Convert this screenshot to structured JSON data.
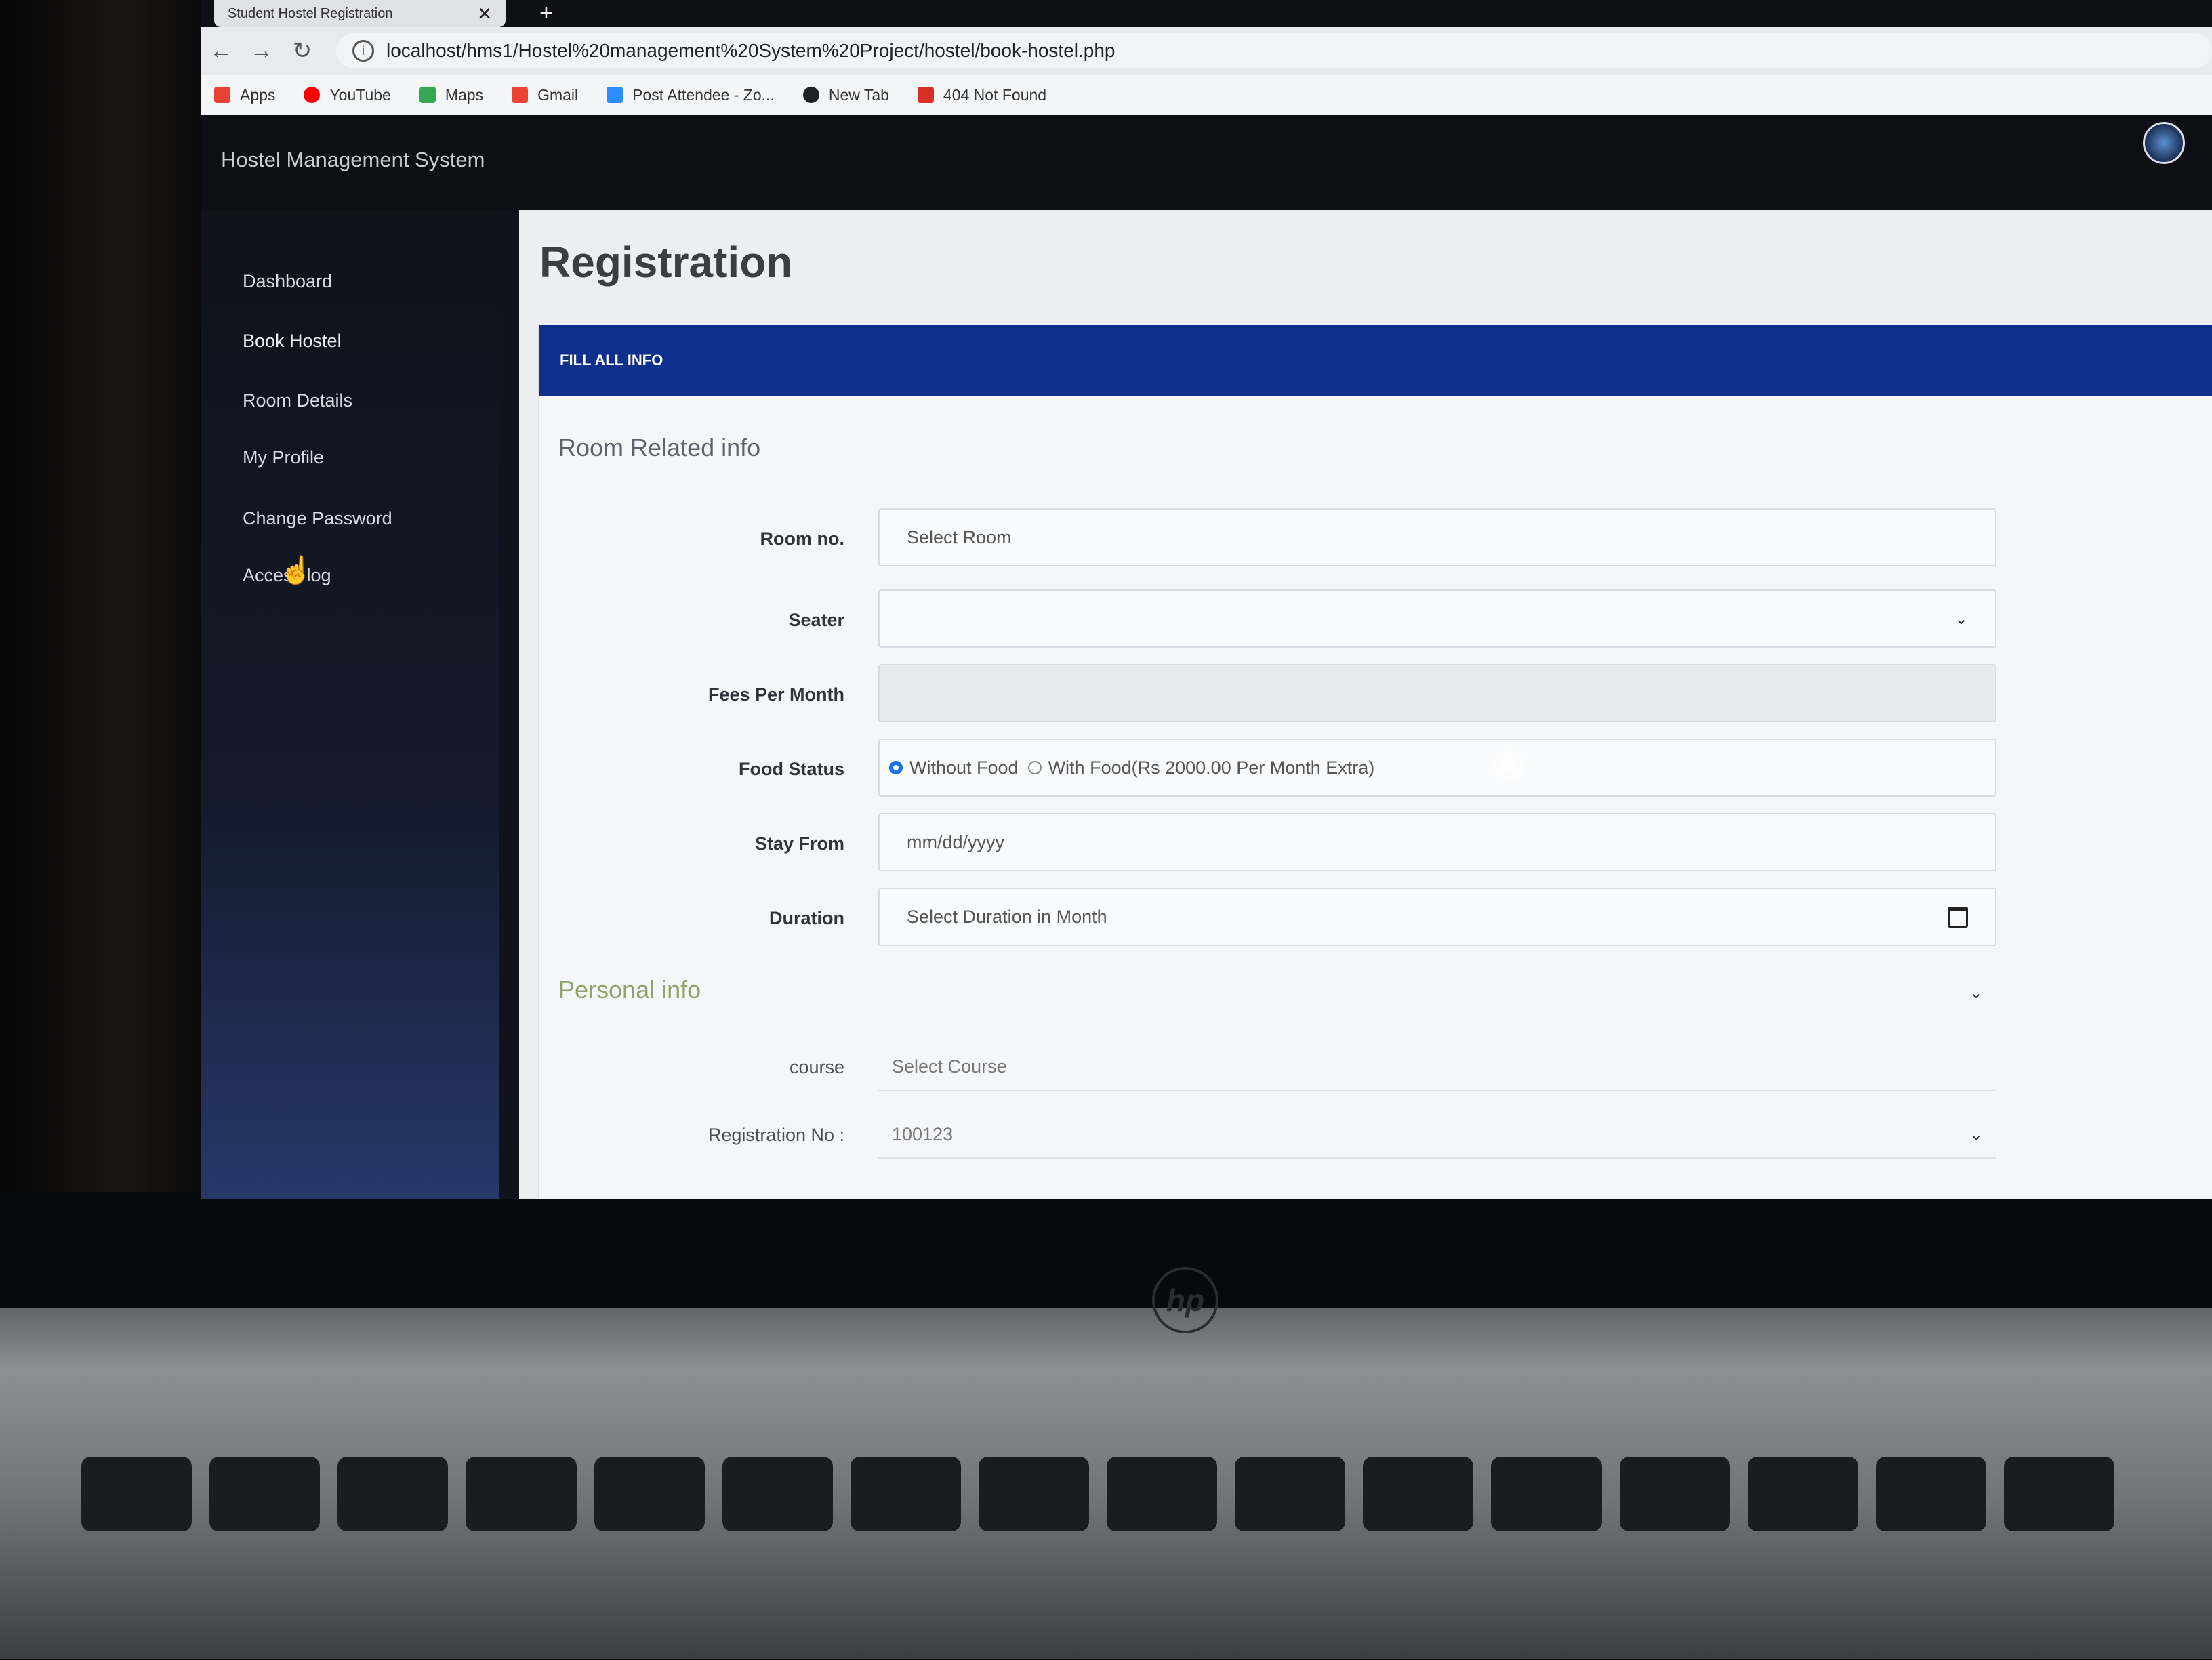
{
  "browser": {
    "tab_title": "Student Hostel Registration",
    "tab_close": "✕",
    "new_tab": "+",
    "url": "localhost/hms1/Hostel%20management%20System%20Project/hostel/book-hostel.php",
    "bookmarks": [
      {
        "label": "Apps",
        "color": "#e94235"
      },
      {
        "label": "YouTube",
        "color": "#ff0000"
      },
      {
        "label": "Maps",
        "color": "#34a853"
      },
      {
        "label": "Gmail",
        "color": "#ea4335"
      },
      {
        "label": "Post Attendee - Zo...",
        "color": "#2d8cff"
      },
      {
        "label": "New Tab",
        "color": "#202124"
      },
      {
        "label": "404 Not Found",
        "color": "#d93025"
      }
    ]
  },
  "app": {
    "brand": "Hostel Management System"
  },
  "sidebar": {
    "items": [
      {
        "label": "Dashboard"
      },
      {
        "label": "Book Hostel"
      },
      {
        "label": "Room Details"
      },
      {
        "label": "My Profile"
      },
      {
        "label": "Change Password"
      },
      {
        "label": "Access log"
      }
    ]
  },
  "page": {
    "title": "Registration",
    "panel_heading": "FILL ALL INFO"
  },
  "room_section": {
    "title": "Room Related info",
    "room_no_label": "Room no.",
    "room_no_value": "Select Room",
    "seater_label": "Seater",
    "fees_label": "Fees Per Month",
    "food_label": "Food Status",
    "food_option_1": "Without Food",
    "food_option_2": "With Food(Rs 2000.00 Per Month Extra)",
    "stay_from_label": "Stay From",
    "stay_from_placeholder": "mm/dd/yyyy",
    "duration_label": "Duration",
    "duration_value": "Select Duration in Month"
  },
  "personal_section": {
    "title": "Personal info",
    "course_label": "course",
    "course_value": "Select Course",
    "reg_no_label": "Registration No :",
    "reg_no_value": "100123"
  },
  "colors": {
    "panel_heading": "#0e2f8c",
    "personal_title": "#8fa36a"
  }
}
